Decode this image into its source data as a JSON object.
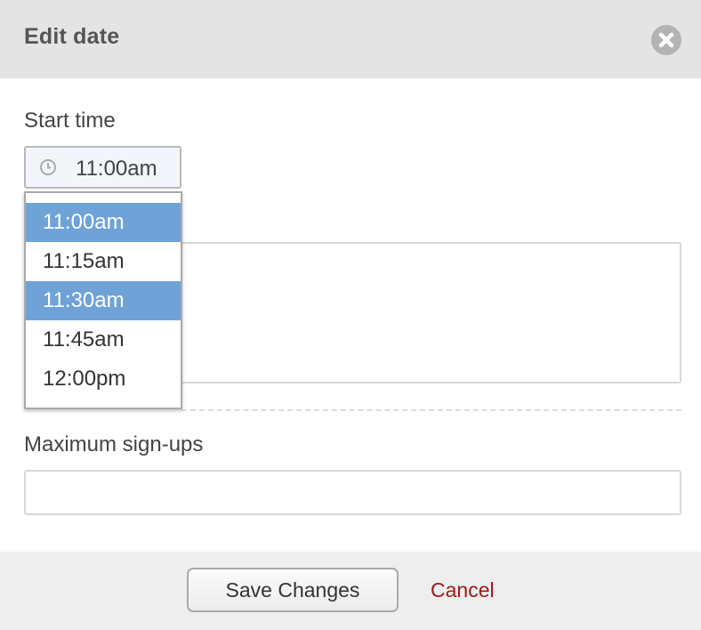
{
  "dialog": {
    "title": "Edit date",
    "close_icon": "close-circle-icon"
  },
  "start_time": {
    "label": "Start time",
    "value": "11:00am",
    "icon": "clock-icon"
  },
  "time_options": [
    {
      "label": "11:00am",
      "selected": true
    },
    {
      "label": "11:15am",
      "selected": false
    },
    {
      "label": "11:30am",
      "selected": true
    },
    {
      "label": "11:45am",
      "selected": false
    },
    {
      "label": "12:00pm",
      "selected": false
    }
  ],
  "max_signups": {
    "label": "Maximum sign-ups",
    "value": ""
  },
  "footer": {
    "save_label": "Save Changes",
    "cancel_label": "Cancel"
  },
  "colors": {
    "header_bg": "#e4e4e4",
    "option_highlight": "#6fa3d8",
    "cancel_link": "#a01818"
  }
}
